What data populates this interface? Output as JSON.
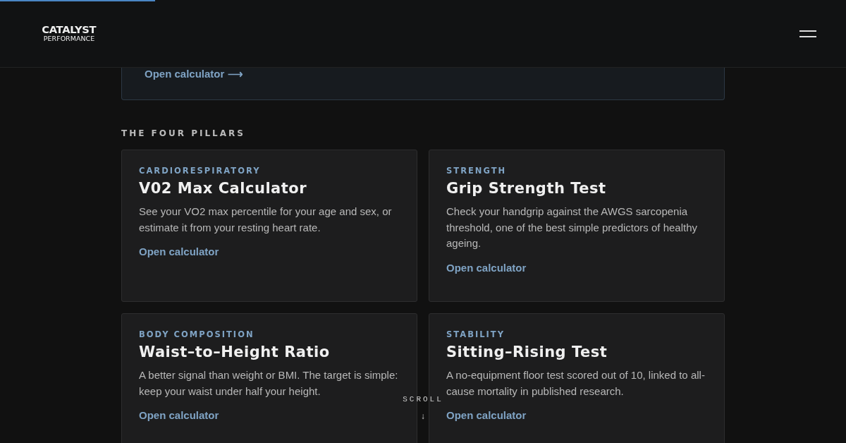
{
  "scroll_progress": {
    "level": 0.183
  },
  "header": {
    "logo_top": "CATALYST",
    "logo_bottom": "PERFORMANCE"
  },
  "featured_card": {
    "link": "Open calculator ⟶"
  },
  "section_title": "THE FOUR PILLARS",
  "cards": [
    {
      "category": "CARDIORESPIRATORY",
      "title": "V02 Max Calculator",
      "description": "See your VO2 max percentile for your age and sex, or estimate it from your resting heart rate.",
      "link": "Open calculator"
    },
    {
      "category": "STRENGTH",
      "title": "Grip Strength Test",
      "description": "Check your handgrip against the AWGS sarcopenia threshold, one of the best simple predictors of healthy ageing.",
      "link": "Open calculator"
    },
    {
      "category": "BODY COMPOSITION",
      "title": "Waist–to–Height Ratio",
      "description": "A better signal than weight or BMI. The target is simple: keep your waist under half your height.",
      "link": "Open calculator"
    },
    {
      "category": "STABILITY",
      "title": "Sitting–Rising Test",
      "description": "A no-equipment floor test scored out of 10, linked to all-cause mortality in published research.",
      "link": "Open calculator"
    }
  ],
  "scroll_hint": {
    "label": "SCROLL",
    "arrow": "↓"
  }
}
